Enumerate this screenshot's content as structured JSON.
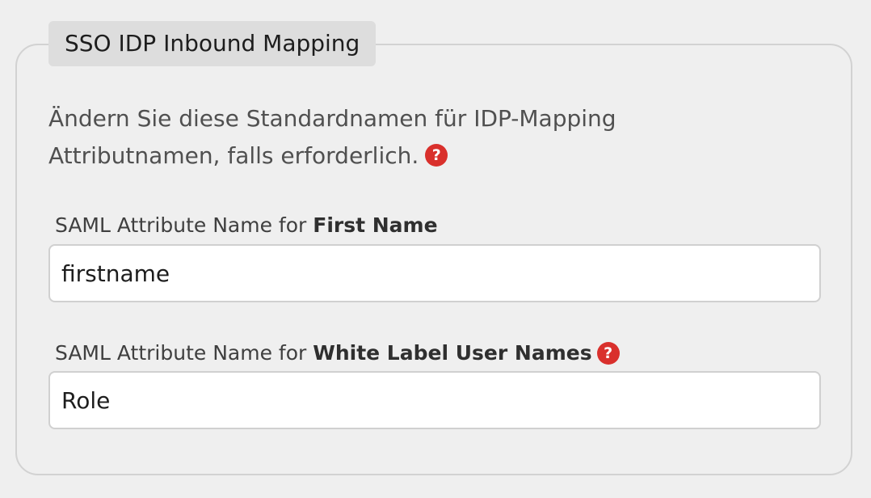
{
  "section": {
    "legend": "SSO IDP Inbound Mapping",
    "intro_line1": "Ändern Sie diese Standardnamen für IDP-Mapping",
    "intro_line2": "Attributnamen, falls erforderlich."
  },
  "help_icon_glyph": "?",
  "fields": {
    "first_name": {
      "label_prefix": "SAML Attribute Name for ",
      "label_bold": "First Name",
      "value": "firstname"
    },
    "white_label": {
      "label_prefix": "SAML Attribute Name for ",
      "label_bold": "White Label User Names",
      "value": "Role"
    }
  },
  "colors": {
    "background": "#efefef",
    "legend_bg": "#dddddd",
    "help_icon": "#d9302c",
    "input_border": "#d0d0d0"
  }
}
